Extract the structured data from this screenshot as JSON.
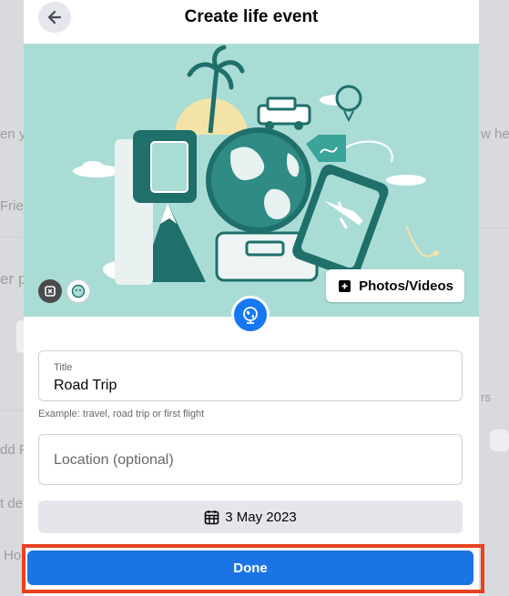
{
  "background": {
    "fragments": [
      "en y",
      "Frie",
      "er p",
      "dd F",
      "t de",
      "Ho",
      "w her",
      "rs"
    ]
  },
  "modal": {
    "title": "Create life event",
    "photos_button_label": "Photos/Videos",
    "title_field": {
      "label": "Title",
      "value": "Road Trip"
    },
    "title_hint": "Example: travel, road trip or first flight",
    "location_field": {
      "placeholder": "Location (optional)"
    },
    "date_label": "3 May 2023",
    "done_label": "Done"
  },
  "colors": {
    "accent": "#1b74e4",
    "highlight": "#e8411e",
    "hero_bg": "#aadcd6",
    "hero_teal": "#1f6f6a"
  },
  "icons": [
    "back-arrow-icon",
    "photo-add-icon",
    "globe-icon",
    "calendar-icon",
    "remove-photo-icon",
    "emoji-icon"
  ]
}
